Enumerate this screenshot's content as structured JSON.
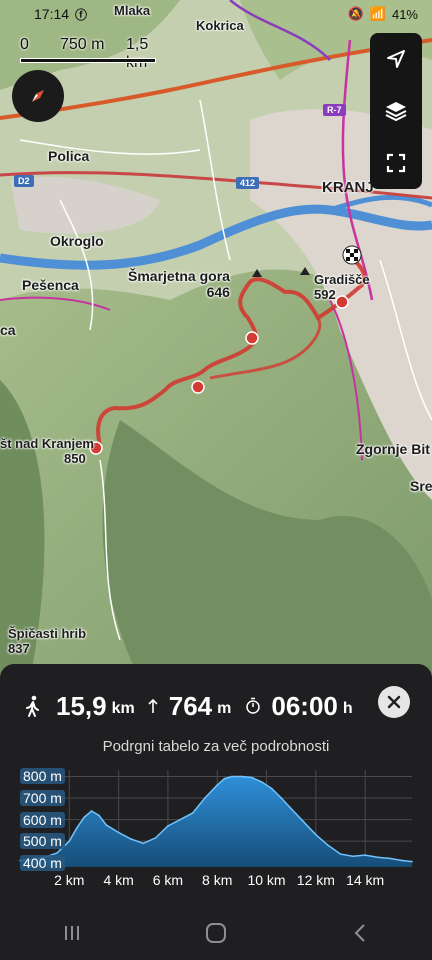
{
  "status": {
    "time": "17:14",
    "battery": "41%"
  },
  "scale": {
    "zero": "0",
    "mid": "750 m",
    "end": "1,5 km"
  },
  "places": [
    {
      "name": "Mlaka"
    },
    {
      "name": "Kokrica"
    },
    {
      "name": "Polica"
    },
    {
      "name": "KRANJ"
    },
    {
      "name": "Okroglo"
    },
    {
      "name": "Šmarjetna gora"
    },
    {
      "name": "Gradišče"
    },
    {
      "name": "Pešenca"
    },
    {
      "name": "ca"
    },
    {
      "name": "št nad Kranjem"
    },
    {
      "name": "Zgornje Bit"
    },
    {
      "name": "Sre"
    },
    {
      "name": "Špičasti hrib"
    }
  ],
  "peaks": {
    "smarjetna": "646",
    "gradisce": "592",
    "kranjem": "850",
    "spicasti": "837"
  },
  "roads": {
    "d2": "D2",
    "r412": "412",
    "r7": "R-7"
  },
  "colors": {
    "route": "#d23a32",
    "bike": "#c7339f",
    "road": "#d85a2a",
    "water": "#4e8fd6"
  },
  "controls": {
    "locate": "navigation-arrow-icon",
    "layers": "layers-icon",
    "fullscreen": "fullscreen-icon"
  },
  "stats": {
    "distance": "15,9",
    "distance_unit": "km",
    "ascent": "764",
    "ascent_unit": "m",
    "duration": "06:00",
    "duration_unit": "h"
  },
  "hint": "Podrgni tabelo za več podrobnosti",
  "chart_data": {
    "type": "area",
    "title": "",
    "xlabel": "",
    "ylabel": "",
    "x_ticks": [
      "2 km",
      "4 km",
      "6 km",
      "8 km",
      "10 km",
      "12 km",
      "14 km"
    ],
    "y_ticks": [
      "400 m",
      "500 m",
      "600 m",
      "700 m",
      "800 m"
    ],
    "ylim": [
      380,
      830
    ],
    "xlim": [
      0,
      15.9
    ],
    "series": [
      {
        "x": [
          0,
          0.5,
          1.0,
          1.5,
          2.0,
          2.3,
          2.6,
          2.9,
          3.2,
          3.5,
          4.0,
          4.5,
          5.0,
          5.5,
          6.0,
          6.5,
          7.0,
          7.5,
          8.0,
          8.3,
          8.6,
          9.0,
          9.4,
          9.8,
          10.2,
          10.6,
          11.0,
          11.5,
          12.0,
          12.5,
          13.0,
          13.5,
          14.0,
          14.5,
          15.0,
          15.5,
          15.9
        ],
        "y": [
          410,
          415,
          425,
          445,
          500,
          560,
          610,
          640,
          620,
          575,
          540,
          510,
          490,
          515,
          570,
          600,
          630,
          700,
          760,
          790,
          800,
          800,
          795,
          775,
          745,
          700,
          650,
          590,
          530,
          480,
          440,
          430,
          435,
          425,
          420,
          410,
          405
        ]
      }
    ]
  }
}
